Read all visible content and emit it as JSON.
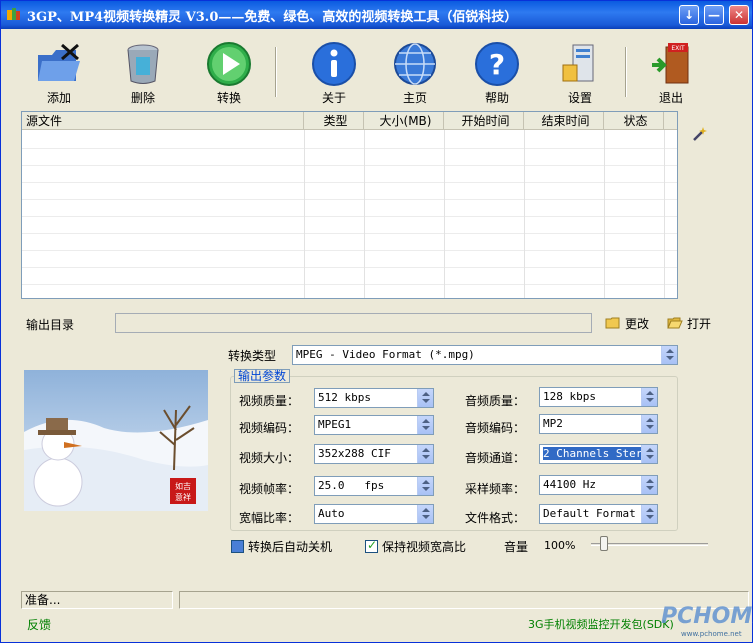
{
  "window": {
    "title": "3GP、MP4视频转换精灵 V3.0——免费、绿色、高效的视频转换工具（佰锐科技）",
    "buttons": [
      "↓",
      "—",
      "✕"
    ]
  },
  "toolbar": {
    "add": "添加",
    "delete": "删除",
    "convert": "转换",
    "about": "关于",
    "home": "主页",
    "help": "帮助",
    "settings": "设置",
    "exit": "退出"
  },
  "file_list": {
    "columns": [
      "源文件",
      "类型",
      "大小(MB)",
      "开始时间",
      "结束时间",
      "状态"
    ],
    "rows": []
  },
  "output_dir": {
    "label": "输出目录",
    "value": "",
    "change_label": "更改",
    "open_label": "打开"
  },
  "convert_type": {
    "label": "转换类型",
    "value": "MPEG - Video Format (*.mpg)"
  },
  "output_params": {
    "title": "输出参数",
    "video_quality_label": "视频质量：",
    "video_quality": "512 kbps",
    "video_codec_label": "视频编码：",
    "video_codec": "MPEG1",
    "video_size_label": "视频大小：",
    "video_size": "352x288 CIF",
    "frame_rate_label": "视频帧率：",
    "frame_rate": "25.0   fps",
    "aspect_label": "宽幅比率：",
    "aspect": "Auto",
    "audio_quality_label": "音频质量：",
    "audio_quality": "128 kbps",
    "audio_codec_label": "音频编码：",
    "audio_codec": "MP2",
    "audio_channel_label": "音频通道：",
    "audio_channel": "2 Channels Stereo",
    "sample_rate_label": "采样频率：",
    "sample_rate": "44100 Hz",
    "file_format_label": "文件格式：",
    "file_format": "Default Format"
  },
  "options": {
    "auto_shutdown": "转换后自动关机",
    "keep_ratio": "保持视频宽高比",
    "volume_label": "音量",
    "volume_value": "100%",
    "volume_level": 0.08
  },
  "stamp": "如意吉祥",
  "status": {
    "text": "准备...",
    "feedback": "反馈",
    "promo": "3G手机视频监控开发包(SDK)",
    "watermark": "PCHOME",
    "watermark_url": "www.pchome.net"
  },
  "colors": {
    "title_bar": "#0a5be0",
    "window_bg": "#ece9d8",
    "link_green": "#008000",
    "selected": "#316ac5"
  }
}
